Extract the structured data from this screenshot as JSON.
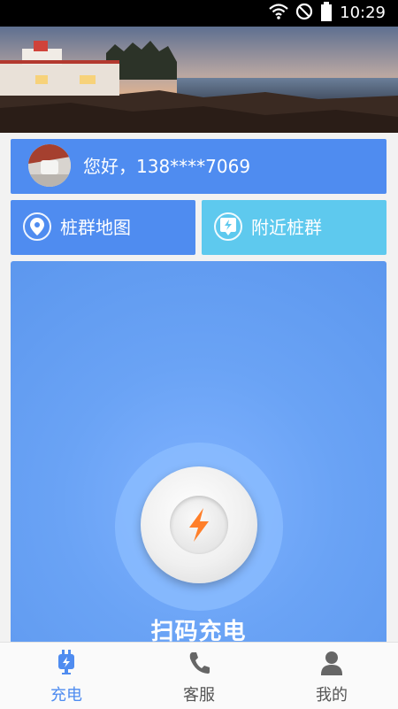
{
  "status_bar": {
    "time": "10:29",
    "icons": [
      "wifi-icon",
      "do-not-disturb-icon",
      "battery-icon"
    ]
  },
  "banner": {
    "slide_count": 2,
    "active_slide": 1
  },
  "greeting": {
    "text": "您好，138****7069"
  },
  "quick_actions": [
    {
      "label": "桩群地图",
      "icon": "location-pin-icon"
    },
    {
      "label": "附近桩群",
      "icon": "lightning-marker-icon"
    }
  ],
  "scan": {
    "label": "扫码充电",
    "icon": "lightning-icon"
  },
  "bottom_nav": [
    {
      "label": "充电",
      "icon": "charging-plug-icon",
      "active": true
    },
    {
      "label": "客服",
      "icon": "phone-icon",
      "active": false
    },
    {
      "label": "我的",
      "icon": "user-icon",
      "active": false
    }
  ],
  "colors": {
    "primary_blue": "#4f8cf0",
    "light_blue": "#5ec9ee",
    "accent_orange": "#ff8a3d"
  }
}
